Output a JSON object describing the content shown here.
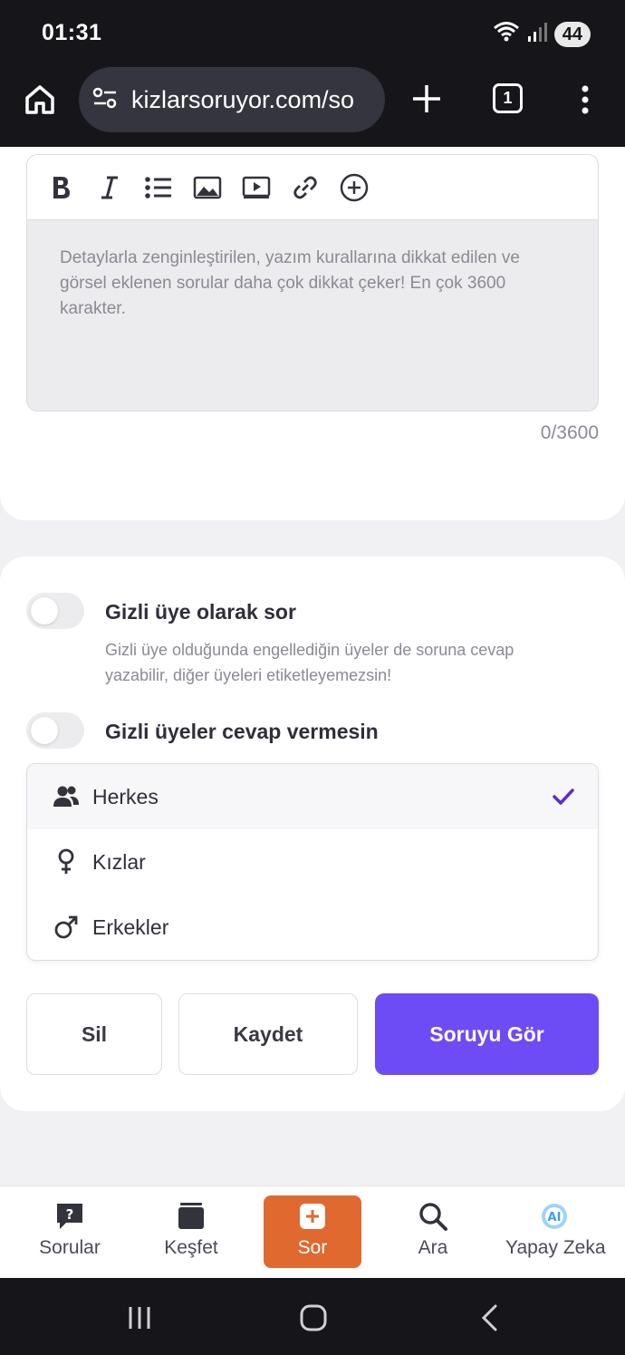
{
  "status_bar": {
    "time": "01:31",
    "battery": "44"
  },
  "browser": {
    "url": "kizlarsoruyor.com/so",
    "tab_count": "1"
  },
  "editor": {
    "toolbar_icons": [
      "bold-icon",
      "italic-icon",
      "list-icon",
      "image-icon",
      "video-icon",
      "link-icon",
      "add-circle-icon"
    ],
    "placeholder": "Detaylarla zenginleştirilen, yazım kurallarına dikkat edilen ve görsel eklenen sorular daha çok dikkat çeker! En çok 3600 karakter.",
    "counter": "0/3600"
  },
  "options": {
    "anonymous": {
      "title": "Gizli üye olarak sor",
      "description": "Gizli üye olduğunda engellediğin üyeler de soruna cevap yazabilir, diğer üyeleri etiketleyemezsin!"
    },
    "no_anonymous_answers": {
      "title": "Gizli üyeler cevap vermesin"
    }
  },
  "audience_dropdown": {
    "items": [
      {
        "label": "Herkes",
        "icon": "users-icon",
        "selected": true
      },
      {
        "label": "Kızlar",
        "icon": "female-icon",
        "selected": false
      },
      {
        "label": "Erkekler",
        "icon": "male-icon",
        "selected": false
      }
    ]
  },
  "actions": {
    "delete": "Sil",
    "save": "Kaydet",
    "preview": "Soruyu Gör"
  },
  "bottom_nav": {
    "items": [
      {
        "label": "Sorular",
        "icon": "question-bubble-icon"
      },
      {
        "label": "Keşfet",
        "icon": "cards-icon"
      },
      {
        "label": "Sor",
        "icon": "add-icon",
        "active": true
      },
      {
        "label": "Ara",
        "icon": "search-icon"
      },
      {
        "label": "Yapay Zeka",
        "icon": "ai-icon"
      }
    ]
  },
  "colors": {
    "primary": "#6d4bf5",
    "accent_orange": "#e0692f",
    "dark_bar": "#16161a"
  }
}
